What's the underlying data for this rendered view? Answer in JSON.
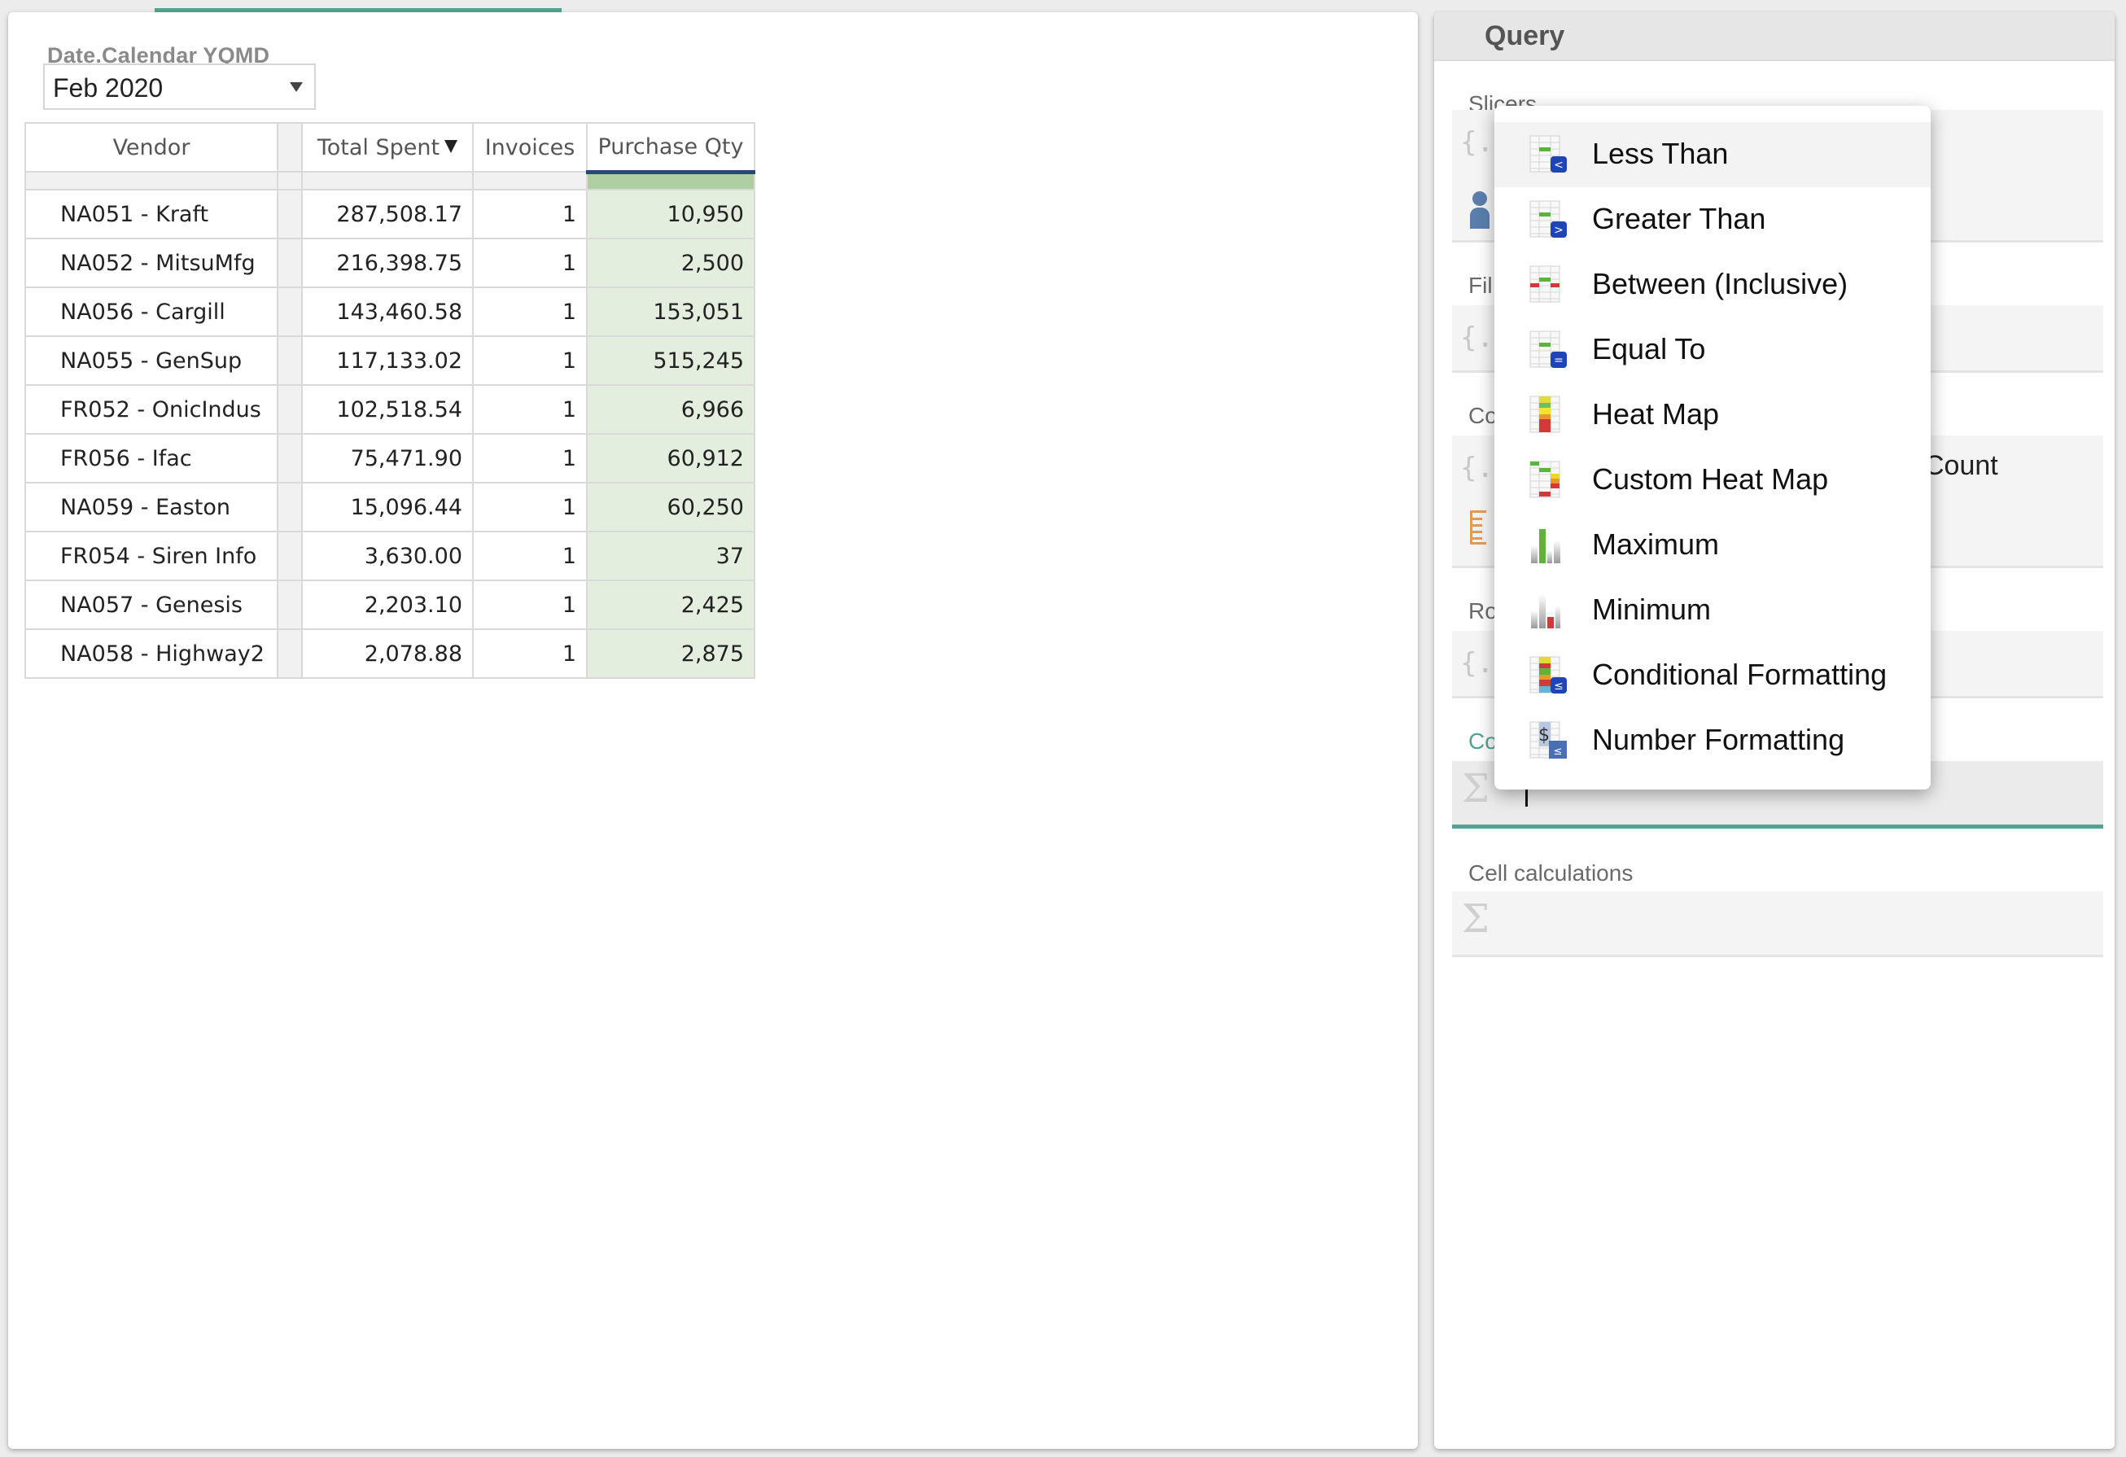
{
  "slicer": {
    "label": "Date.Calendar YQMD",
    "selected_value": "Feb 2020"
  },
  "grid": {
    "columns": [
      "Vendor",
      "",
      "Total Spent",
      "Invoices",
      "Purchase Qty"
    ],
    "sort": {
      "column": "Total Spent",
      "direction": "descending"
    },
    "rows": [
      {
        "vendor": "NA051 - Kraft",
        "total_spent": "287,508.17",
        "invoices": "1",
        "purchase_qty": "10,950"
      },
      {
        "vendor": "NA052 - MitsuMfg",
        "total_spent": "216,398.75",
        "invoices": "1",
        "purchase_qty": "2,500"
      },
      {
        "vendor": "NA056 - Cargill",
        "total_spent": "143,460.58",
        "invoices": "1",
        "purchase_qty": "153,051"
      },
      {
        "vendor": "NA055 - GenSup",
        "total_spent": "117,133.02",
        "invoices": "1",
        "purchase_qty": "515,245"
      },
      {
        "vendor": "FR052 - OnicIndus",
        "total_spent": "102,518.54",
        "invoices": "1",
        "purchase_qty": "6,966"
      },
      {
        "vendor": "FR056 - Ifac",
        "total_spent": "75,471.90",
        "invoices": "1",
        "purchase_qty": "60,912"
      },
      {
        "vendor": "NA059 - Easton",
        "total_spent": "15,096.44",
        "invoices": "1",
        "purchase_qty": "60,250"
      },
      {
        "vendor": "FR054 - Siren Info",
        "total_spent": "3,630.00",
        "invoices": "1",
        "purchase_qty": "37"
      },
      {
        "vendor": "NA057 - Genesis",
        "total_spent": "2,203.10",
        "invoices": "1",
        "purchase_qty": "2,425"
      },
      {
        "vendor": "NA058 - Highway2",
        "total_spent": "2,078.88",
        "invoices": "1",
        "purchase_qty": "2,875"
      }
    ]
  },
  "query_panel": {
    "title": "Query",
    "sections": {
      "slicers": "Slicers",
      "filters_partial": "Fil",
      "columns_partial": "Co",
      "rows_partial": "Ro",
      "calc_partial": "Co",
      "cell_calculations": "Cell calculations"
    },
    "columns_value_partial": "Count",
    "brace_icon": "{...}",
    "sigma_icon": "Σ"
  },
  "context_menu": {
    "items": [
      {
        "label": "Less Than",
        "icon": "less-than-icon",
        "hovered": true
      },
      {
        "label": "Greater Than",
        "icon": "greater-than-icon"
      },
      {
        "label": "Between (Inclusive)",
        "icon": "between-icon"
      },
      {
        "label": "Equal To",
        "icon": "equal-to-icon"
      },
      {
        "label": "Heat Map",
        "icon": "heat-map-icon"
      },
      {
        "label": "Custom Heat Map",
        "icon": "custom-heat-map-icon"
      },
      {
        "label": "Maximum",
        "icon": "maximum-icon"
      },
      {
        "label": "Minimum",
        "icon": "minimum-icon"
      },
      {
        "label": "Conditional Formatting",
        "icon": "conditional-formatting-icon"
      },
      {
        "label": "Number Formatting",
        "icon": "number-formatting-icon"
      }
    ]
  },
  "colors": {
    "accent": "#52a391",
    "column_highlight": "#e3eedf",
    "header_underline": "#27496d"
  }
}
